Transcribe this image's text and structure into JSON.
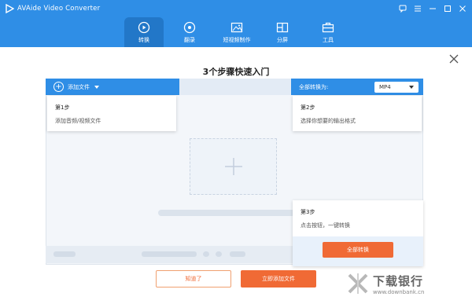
{
  "app": {
    "title": "AVAide Video Converter"
  },
  "nav": {
    "tabs": [
      {
        "label": "转换",
        "icon": "convert-icon",
        "active": true
      },
      {
        "label": "翻录",
        "icon": "disc-icon"
      },
      {
        "label": "短视频制作",
        "icon": "image-video-icon"
      },
      {
        "label": "分屏",
        "icon": "split-screen-icon"
      },
      {
        "label": "工具",
        "icon": "toolbox-icon"
      }
    ]
  },
  "guide": {
    "heading": "3个步骤快速入门",
    "add_file_label": "添加文件",
    "convert_all_to_label": "全部转换为:",
    "format_value": "MP4",
    "step1": {
      "title": "第1步",
      "desc": "添加音频/视频文件"
    },
    "step2": {
      "title": "第2步",
      "desc": "选择你想要的输出格式"
    },
    "step3": {
      "title": "第3步",
      "desc": "点击按钮，一键转换",
      "button": "全部转换"
    },
    "got_it": "知道了",
    "add_now": "立即添加文件"
  },
  "watermark": {
    "title": "下载银行",
    "url": "www.downbank.cn"
  },
  "colors": {
    "primary": "#2f8ee6",
    "accent": "#f06a35"
  }
}
